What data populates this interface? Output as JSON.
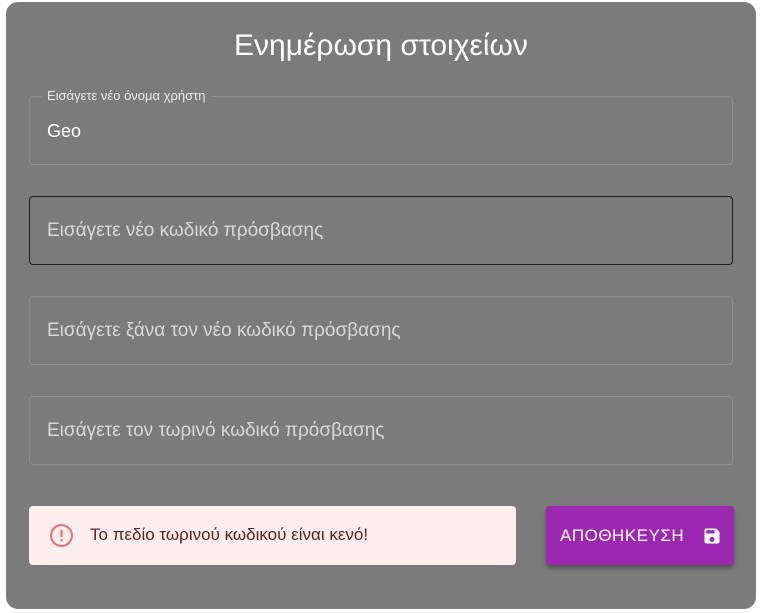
{
  "dialog": {
    "title": "Ενημέρωση στοιχείων"
  },
  "fields": {
    "username": {
      "label": "Εισάγετε νέο όνομα χρήστη",
      "value": "Geo"
    },
    "new_password": {
      "placeholder": "Εισάγετε νέο κωδικό πρόσβασης"
    },
    "confirm_password": {
      "placeholder": "Εισάγετε ξάνα τον νέο κωδικό πρόσβασης"
    },
    "current_password": {
      "placeholder": "Εισάγετε τον τωρινό κωδικό πρόσβασης"
    }
  },
  "alert": {
    "icon": "error-outline-icon",
    "message": "Το πεδίο τωρινού κωδικού είναι κενό!",
    "color": "#d32f2f"
  },
  "actions": {
    "save_label": "ΑΠΟΘΗΚΕΥΣΗ",
    "save_icon": "save-icon",
    "accent": "#9c27b0"
  }
}
